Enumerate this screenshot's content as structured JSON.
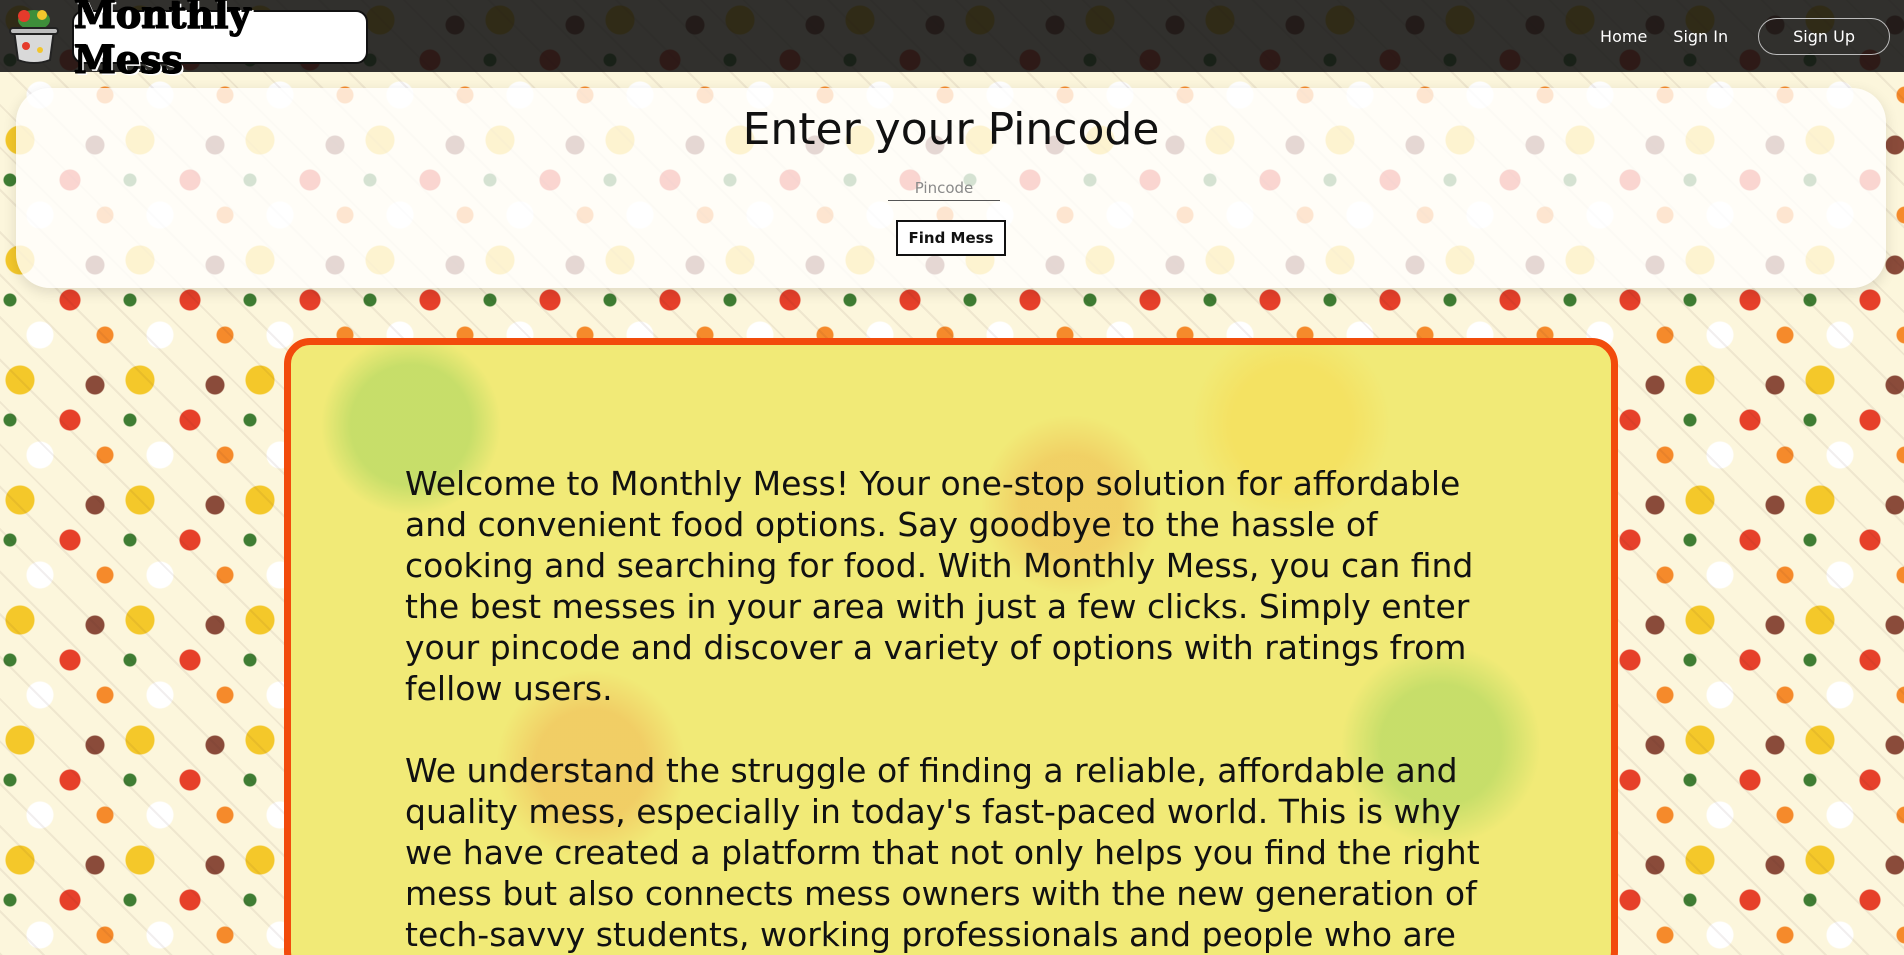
{
  "nav": {
    "brand": "Monthly Mess",
    "links": [
      "Home",
      "Sign In"
    ],
    "signup": "Sign Up"
  },
  "pincode": {
    "title": "Enter your Pincode",
    "placeholder": "Pincode",
    "button": "Find Mess"
  },
  "welcome": {
    "paragraph1": "Welcome to Monthly Mess! Your one-stop solution for affordable and convenient food options. Say goodbye to the hassle of cooking and searching for food. With Monthly Mess, you can find the best messes in your area with just a few clicks. Simply enter your pincode and discover a variety of options with ratings from fellow users.",
    "paragraph2": "We understand the struggle of finding a reliable, affordable and quality mess, especially in today's fast-paced world. This is why we have created a platform that not only helps you find the right mess but also connects mess owners with the new generation of tech-savvy students, working professionals and people who are"
  },
  "colors": {
    "accent": "#f24b0c",
    "card": "#f1ea77",
    "navbar": "#141414"
  },
  "icons": [
    "cooking-pot-icon"
  ]
}
